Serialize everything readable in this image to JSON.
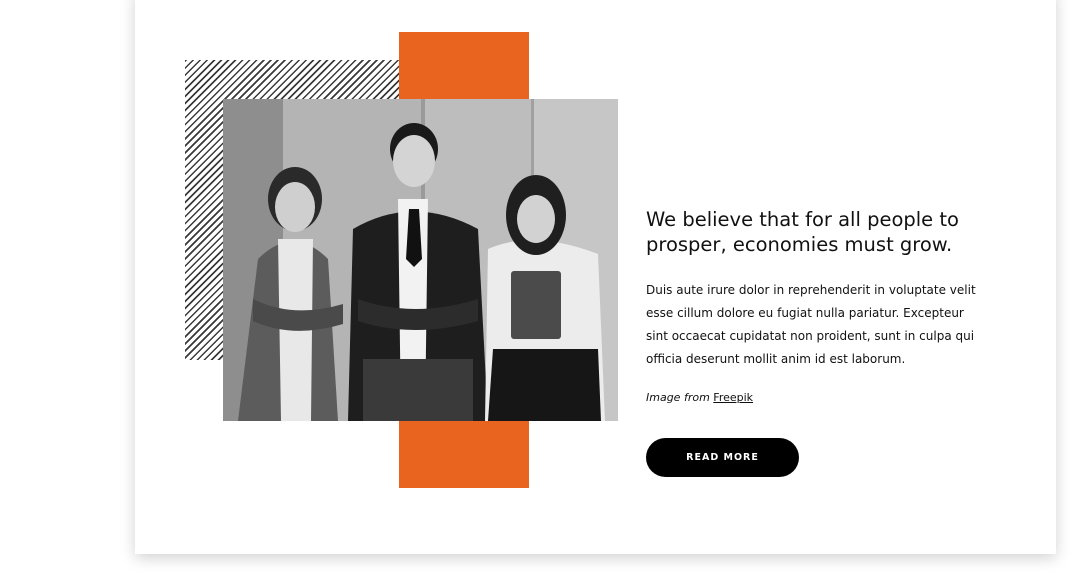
{
  "section": {
    "headline": "We believe that for all people to prosper, economies must grow.",
    "body": "Duis aute irure dolor in reprehenderit in voluptate velit esse cillum dolore eu fugiat nulla pariatur. Excepteur sint occaecat cupidatat non proident, sunt in culpa qui officia deserunt mollit anim id est laborum.",
    "credit_prefix": "Image from",
    "credit_link": "Freepik",
    "button_label": "READ MORE"
  },
  "colors": {
    "accent": "#e8641f",
    "button": "#000000",
    "text": "#111111"
  },
  "icons": {
    "pattern": "diagonal-hatch-pattern"
  }
}
